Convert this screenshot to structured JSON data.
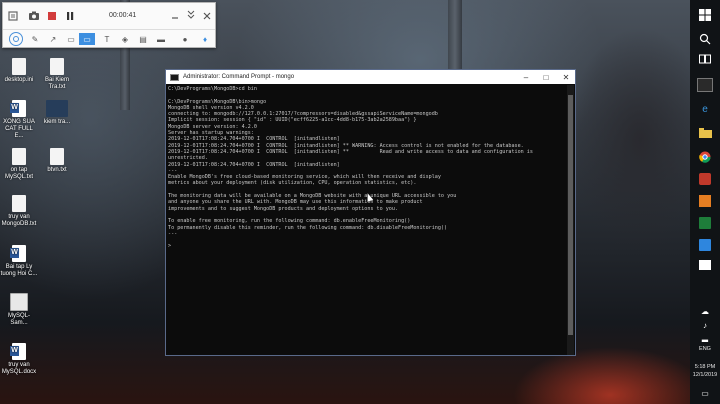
{
  "recorder": {
    "time": "00:00:41",
    "controls": [
      "camera-icon",
      "stop-icon",
      "pause-icon",
      "minimize-icon",
      "collapse-icon",
      "close-icon"
    ],
    "tools": [
      "cursor-tool-icon",
      "pen-icon",
      "arrow-icon",
      "rectangle-icon",
      "highlighter-icon",
      "text-icon",
      "eraser-icon",
      "webcam-icon",
      "mic-icon"
    ]
  },
  "desktop_icons": [
    {
      "label": "desktop.ini",
      "kind": "file"
    },
    {
      "label": "Bai Kiem Tra.txt",
      "kind": "file"
    },
    {
      "label": "XONG SUA CAT FULL E...",
      "kind": "word"
    },
    {
      "label": "kiem tra...",
      "kind": "thumb"
    },
    {
      "label": "on tap MySQL.txt",
      "kind": "file"
    },
    {
      "label": "btvn.txt",
      "kind": "file"
    },
    {
      "label": "truy van MongoDB.txt",
      "kind": "file"
    },
    {
      "label": "Bai tap Ly tuong Hoi C...",
      "kind": "word"
    },
    {
      "label": "MySQL-Sam...",
      "kind": "sql"
    },
    {
      "label": "truy van MySQL.docx",
      "kind": "word"
    }
  ],
  "cmd": {
    "title": "Administrator: Command Prompt - mongo",
    "minimize": "–",
    "maximize": "□",
    "close": "✕",
    "lines": [
      "C:\\DevPrograms\\MongoDB>cd bin",
      "",
      "C:\\DevPrograms\\MongoDB\\bin>mongo",
      "MongoDB shell version v4.2.0",
      "connecting to: mongodb://127.0.0.1:27017/?compressors=disabled&gssapiServiceName=mongodb",
      "Implicit session: session { \"id\" : UUID(\"ecff6225-a1cc-4dd8-b175-3ab2a2589baa\") }",
      "MongoDB server version: 4.2.0",
      "Server has startup warnings:",
      "2019-12-01T17:08:24.704+0700 I  CONTROL  [initandlisten]",
      "2019-12-01T17:08:24.704+0700 I  CONTROL  [initandlisten] ** WARNING: Access control is not enabled for the database.",
      "2019-12-01T17:08:24.704+0700 I  CONTROL  [initandlisten] **          Read and write access to data and configuration is",
      "unrestricted.",
      "2019-12-01T17:08:24.704+0700 I  CONTROL  [initandlisten]",
      "---",
      "Enable MongoDB's free cloud-based monitoring service, which will then receive and display",
      "metrics about your deployment (disk utilization, CPU, operation statistics, etc).",
      "",
      "The monitoring data will be available on a MongoDB website with a unique URL accessible to you",
      "and anyone you share the URL with. MongoDB may use this information to make product",
      "improvements and to suggest MongoDB products and deployment options to you.",
      "",
      "To enable free monitoring, run the following command: db.enableFreeMonitoring()",
      "To permanently disable this reminder, run the following command: db.disableFreeMonitoring()",
      "---",
      "",
      ">"
    ]
  },
  "taskbar": {
    "language": "ENG",
    "time": "5:18 PM",
    "date": "12/1/2019"
  }
}
